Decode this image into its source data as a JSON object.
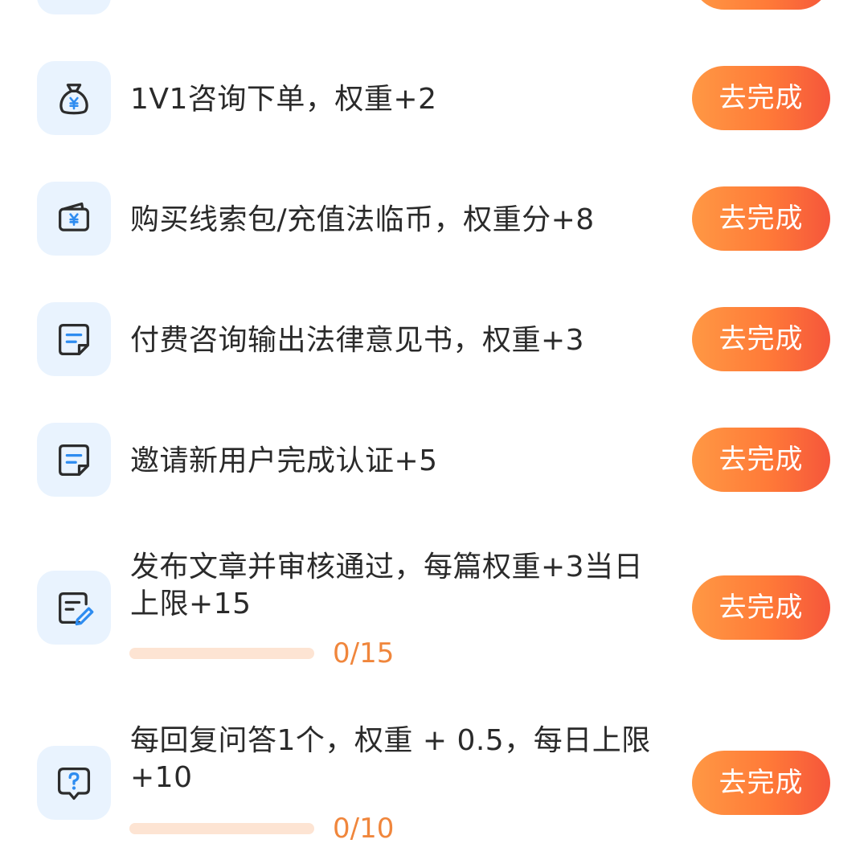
{
  "tasks": [
    {
      "title": "1V1咨询下单，权重+2",
      "button": "去完成",
      "icon": "money-bag-icon"
    },
    {
      "title": "购买线索包/充值法临币，权重分+8",
      "button": "去完成",
      "icon": "wallet-icon"
    },
    {
      "title": "付费咨询输出法律意见书，权重+3",
      "button": "去完成",
      "icon": "document-icon"
    },
    {
      "title": "邀请新用户完成认证+5",
      "button": "去完成",
      "icon": "document-icon"
    },
    {
      "title": "发布文章并审核通过，每篇权重+3当日上限+15",
      "button": "去完成",
      "icon": "edit-document-icon",
      "progress_text": "0/15",
      "progress": 0
    },
    {
      "title": "每回复问答1个，权重 + 0.5，每日上限+10",
      "button": "去完成",
      "icon": "question-chat-icon",
      "progress_text": "0/10",
      "progress": 0
    }
  ],
  "colors": {
    "accent_start": "#ff9844",
    "accent_end": "#f5563b",
    "icon_bg": "#e9f3fe",
    "icon_stroke": "#2c2c2c",
    "icon_accent": "#2e8cf0",
    "progress_text": "#f0863c",
    "progress_track": "#fde4d3"
  }
}
